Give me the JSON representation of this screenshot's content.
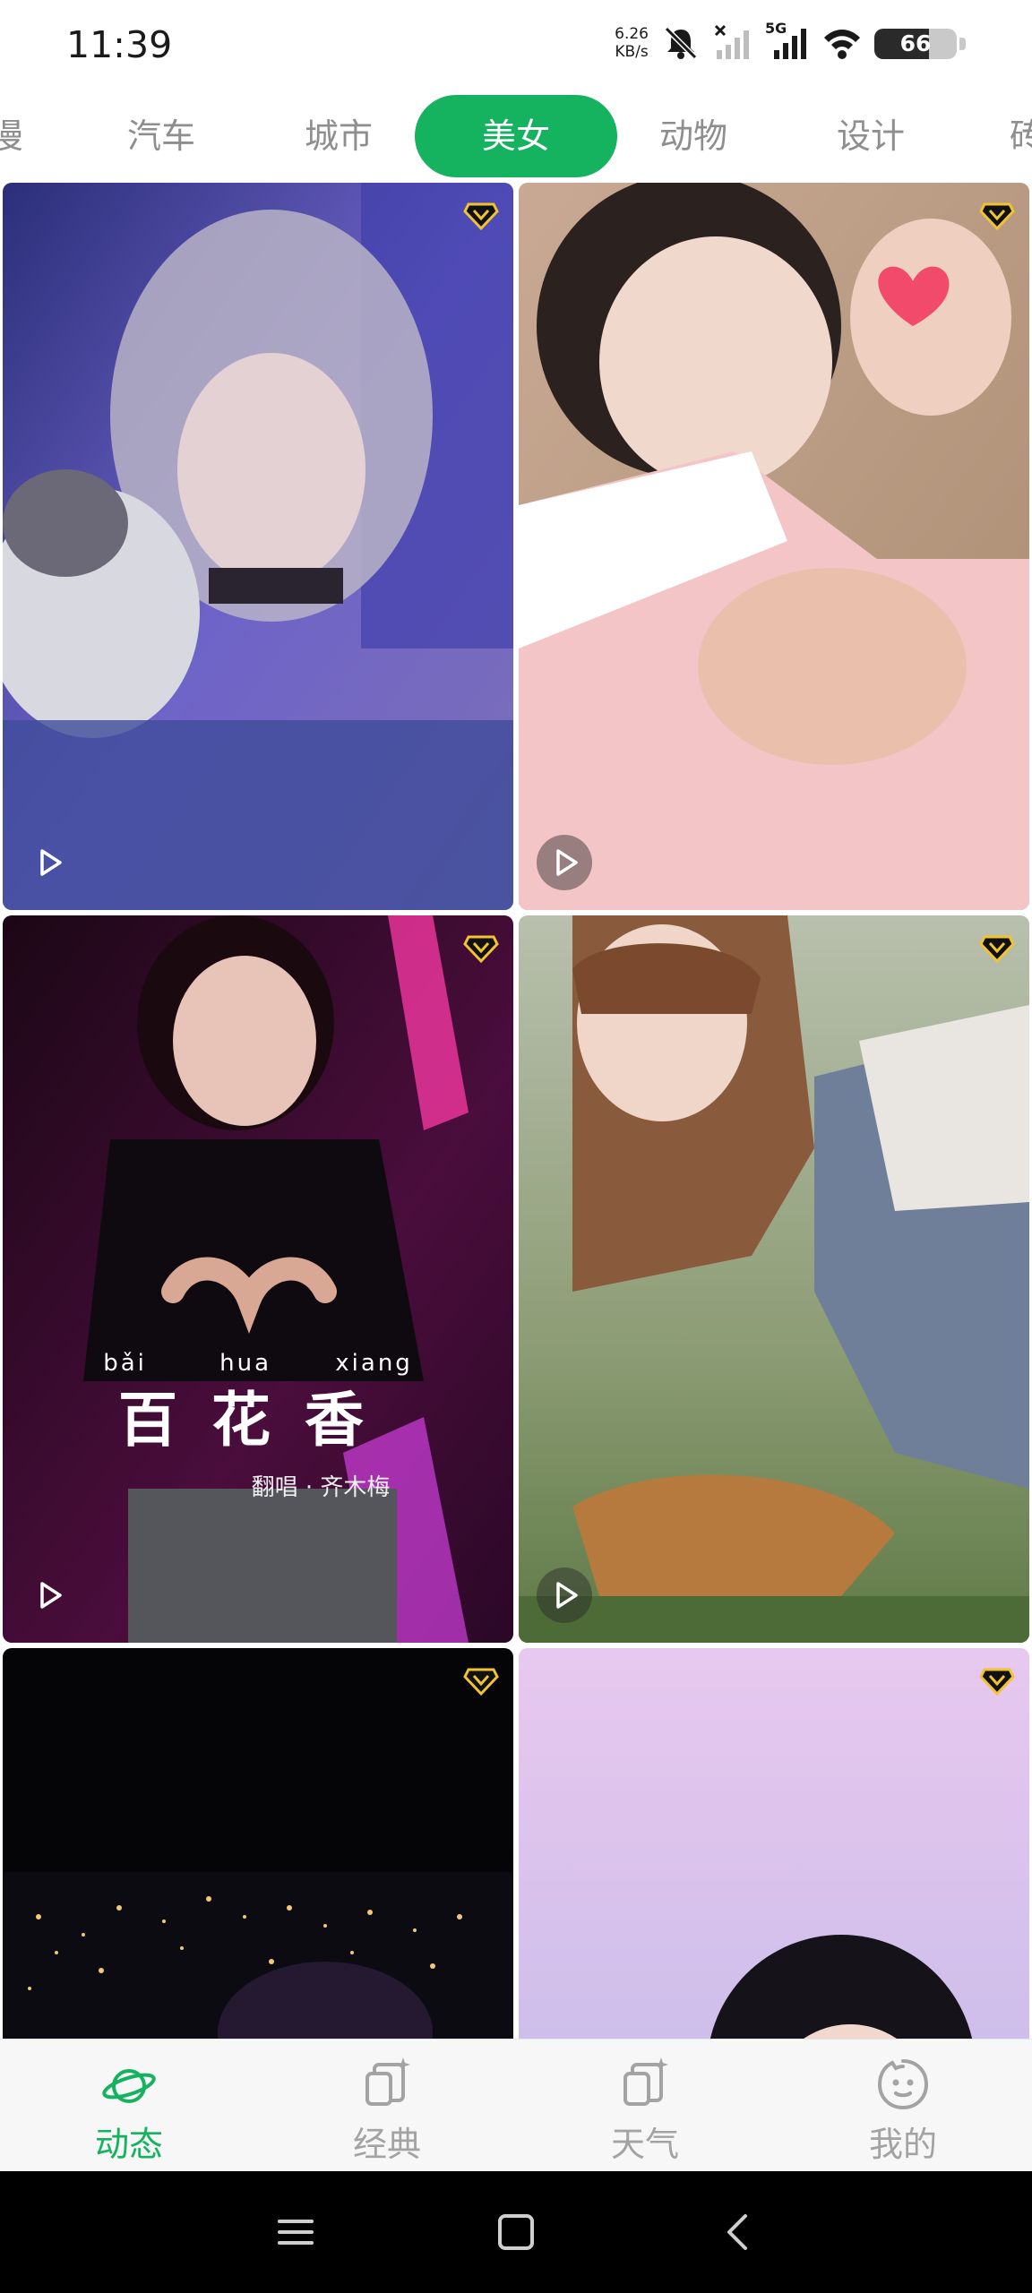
{
  "status_bar": {
    "time": "11:39",
    "net_speed_value": "6.26",
    "net_speed_unit": "KB/s",
    "sim_label": "5G",
    "battery_level": "66",
    "battery_fraction": 0.66,
    "icons": [
      "bell-muted-icon",
      "sim1-no-signal-icon",
      "sim2-signal-icon",
      "wifi-icon",
      "battery-icon"
    ]
  },
  "tabs": {
    "items": [
      "漫",
      "汽车",
      "城市",
      "美女",
      "动物",
      "设计",
      "砖"
    ],
    "active": "美女",
    "active_color": "#15b25f"
  },
  "cards": [
    {
      "vip": true,
      "play": true
    },
    {
      "vip": true,
      "play": true
    },
    {
      "vip": true,
      "play": true,
      "caption_pinyin": [
        "bǎi",
        "hua",
        "xiang"
      ],
      "caption_title": "百花香",
      "caption_credit": "翻唱 · 齐木梅"
    },
    {
      "vip": true,
      "play": true
    },
    {
      "vip": true,
      "play": false
    },
    {
      "vip": true,
      "play": false
    }
  ],
  "bottom_nav": {
    "items": [
      {
        "label": "动态",
        "icon": "planet-icon",
        "active": true
      },
      {
        "label": "经典",
        "icon": "wallpaper-sparkle-icon",
        "active": false
      },
      {
        "label": "天气",
        "icon": "wallpaper-sparkle-icon",
        "active": false
      },
      {
        "label": "我的",
        "icon": "smiley-face-icon",
        "active": false
      }
    ]
  },
  "system_nav": {
    "icons": [
      "menu-icon",
      "home-icon",
      "back-icon"
    ]
  }
}
